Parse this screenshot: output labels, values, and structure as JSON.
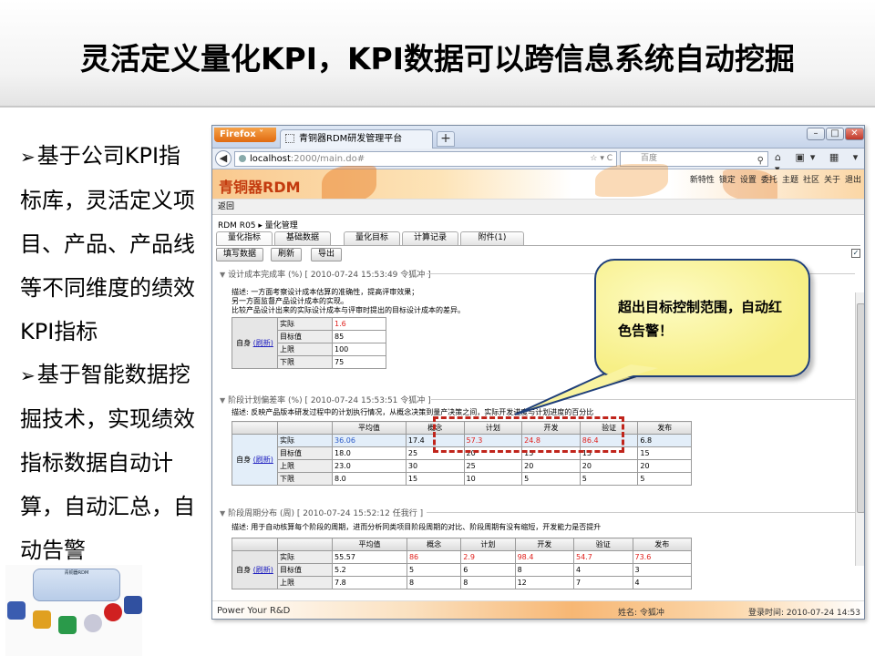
{
  "title": "灵活定义量化KPI，KPI数据可以跨信息系统自动挖掘",
  "bullets": [
    "基于公司KPI指标库，灵活定义项目、产品、产品线等不同维度的绩效KPI指标",
    "基于智能数据挖掘技术，实现绩效指标数据自动计算，自动汇总，自动告警"
  ],
  "thumbnail": {
    "label": "青铜器RDM"
  },
  "browser": {
    "firefox_label": "Firefox ˅",
    "tab_title": "青铜器RDM研发管理平台",
    "new_tab": "+",
    "url_host": "localhost",
    "url_rest": ":2000/main.do#",
    "search_placeholder": "百度"
  },
  "app": {
    "logo": "青铜器RDM",
    "header_links": [
      "新特性",
      "锁定",
      "设置",
      "委托",
      "主题",
      "社区",
      "关于",
      "退出"
    ],
    "back_label": "返回",
    "breadcrumb": "RDM R05  ▸  量化管理",
    "tabs": [
      "量化指标",
      "基础数据",
      "量化目标",
      "计算记录",
      "附件(1)"
    ],
    "toolbar": [
      "填写数据",
      "刷新",
      "导出"
    ],
    "sections": [
      {
        "header": "设计成本完成率 (%) [ 2010-07-24 15:53:49  令狐冲 ]",
        "desc": [
          "描述: 一方面考察设计成本估算的准确性，提高评审效果；",
          "另一方面监督产品设计成本的实现。",
          "比较产品设计出来的实际设计成本与评审时提出的目标设计成本的差异。"
        ],
        "row_head": "自身",
        "refresh": "(刷新)",
        "rows": [
          {
            "label": "实际",
            "value": "1.6"
          },
          {
            "label": "目标值",
            "value": "85"
          },
          {
            "label": "上限",
            "value": "100"
          },
          {
            "label": "下限",
            "value": "75"
          }
        ]
      },
      {
        "header": "阶段计划偏差率 (%) [ 2010-07-24 15:53:51  令狐冲 ]",
        "desc": "描述: 反映产品版本研发过程中的计划执行情况，从概念决策到量产决策之间，实际开发进度与计划进度的百分比",
        "columns": [
          "平均值",
          "概念",
          "计划",
          "开发",
          "验证",
          "发布"
        ],
        "row_head": "自身",
        "refresh": "(刷新)",
        "rows": [
          {
            "label": "实际",
            "values": [
              "36.06",
              "17.4",
              "57.3",
              "24.8",
              "86.4",
              "6.8"
            ]
          },
          {
            "label": "目标值",
            "values": [
              "18.0",
              "25",
              "20",
              "15",
              "15",
              "15"
            ]
          },
          {
            "label": "上限",
            "values": [
              "23.0",
              "30",
              "25",
              "20",
              "20",
              "20"
            ]
          },
          {
            "label": "下限",
            "values": [
              "8.0",
              "15",
              "10",
              "5",
              "5",
              "5"
            ]
          }
        ]
      },
      {
        "header": "阶段周期分布 (周) [ 2010-07-24 15:52:12  任我行 ]",
        "desc": "描述: 用于自动核算每个阶段的周期，进而分析同类项目阶段周期的对比、阶段周期有没有缩短，开发能力是否提升",
        "columns": [
          "平均值",
          "概念",
          "计划",
          "开发",
          "验证",
          "发布"
        ],
        "row_head": "自身",
        "refresh": "(刷新)",
        "rows": [
          {
            "label": "实际",
            "values": [
              "55.57",
              "86",
              "2.9",
              "98.4",
              "54.7",
              "73.6"
            ]
          },
          {
            "label": "目标值",
            "values": [
              "5.2",
              "5",
              "6",
              "8",
              "4",
              "3"
            ]
          },
          {
            "label": "上限",
            "values": [
              "7.8",
              "8",
              "8",
              "12",
              "7",
              "4"
            ]
          }
        ]
      }
    ],
    "footer": {
      "left": "Power Your R&D",
      "user": "姓名: 令狐冲",
      "login_time": "登录时间: 2010-07-24 14:53"
    }
  },
  "callout": "超出目标控制范围，自动红色告警！",
  "colors": {
    "alarm_red": "#e0201c",
    "blue_value": "#2a5ac8",
    "callout_fill": "#f7ef86",
    "logo_orange": "#c33a0e"
  }
}
